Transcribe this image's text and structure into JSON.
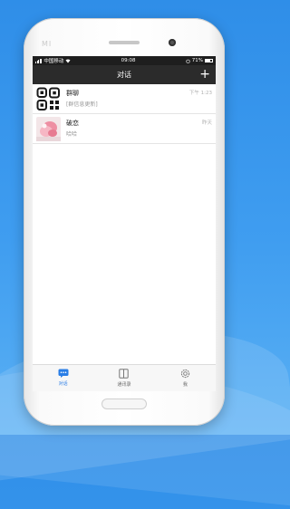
{
  "status_bar": {
    "carrier": "中国移动",
    "time": "09:08",
    "battery": "71%"
  },
  "header": {
    "title": "对话",
    "add_icon": "plus-icon"
  },
  "conversations": [
    {
      "name": "群聊",
      "preview": "[群信息更新]",
      "time": "下午 1:23",
      "avatar": "qr-grid-avatar"
    },
    {
      "name": "破恋",
      "preview": "哈哈",
      "time": "昨天",
      "avatar": "photo-avatar"
    }
  ],
  "tabs": [
    {
      "label": "对话",
      "icon": "chat-icon",
      "active": true
    },
    {
      "label": "通讯录",
      "icon": "contacts-book-icon",
      "active": false
    },
    {
      "label": "我",
      "icon": "settings-gear-icon",
      "active": false
    }
  ],
  "colors": {
    "accent": "#2a7ee6",
    "header_bg": "#2b2b2b",
    "background": "#3f9df0"
  }
}
